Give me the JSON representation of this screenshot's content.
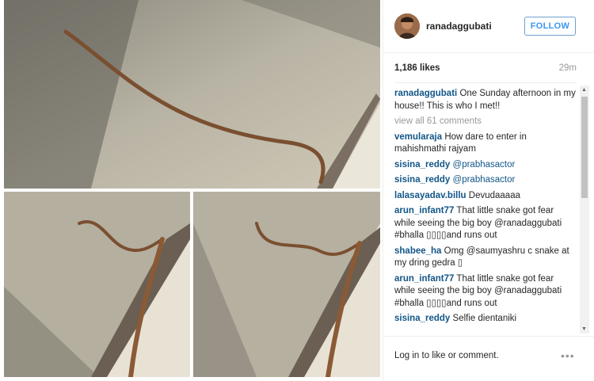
{
  "post": {
    "username": "ranadaggubati",
    "follow_label": "FOLLOW",
    "likes": "1,186 likes",
    "time": "29m"
  },
  "caption": {
    "user": "ranadaggubati",
    "text": "One Sunday afternoon in my house!! This is who I met!!"
  },
  "view_all": "view all 61 comments",
  "comments": [
    {
      "user": "vemularaja",
      "text": "How dare to enter in mahishmathi rajyam"
    },
    {
      "user": "sisina_reddy",
      "text": "@prabhasactor"
    },
    {
      "user": "sisina_reddy",
      "text": "@prabhasactor"
    },
    {
      "user": "lalasayadav.billu",
      "text": "Devudaaaaa"
    },
    {
      "user": "arun_infant77",
      "text": "That little snake got fear while seeing the big boy @ranadaggubati #bhalla ▯▯▯▯and runs out"
    },
    {
      "user": "shabee_ha",
      "text": "Omg @saumyashru c snake at my dring gedra ▯"
    },
    {
      "user": "arun_infant77",
      "text": "That little snake got fear while seeing the big boy @ranadaggubati #bhalla ▯▯▯▯and runs out"
    },
    {
      "user": "sisina_reddy",
      "text": "Selfie dientaniki"
    }
  ],
  "footer": {
    "login_text": "Log in to like or comment.",
    "more": "•••"
  },
  "icons": {
    "more": "more-options-icon",
    "scroll_up": "scroll-up-icon",
    "scroll_down": "scroll-down-icon"
  }
}
